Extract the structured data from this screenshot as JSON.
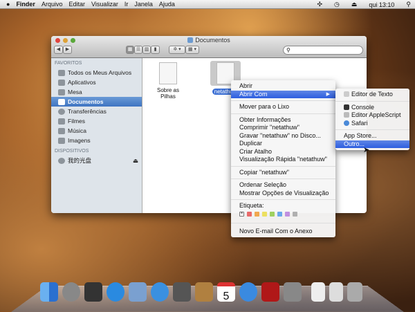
{
  "menubar": {
    "apple": "",
    "items": [
      "Finder",
      "Arquivo",
      "Editar",
      "Visualizar",
      "Ir",
      "Janela",
      "Ajuda"
    ],
    "clock": "qui 13:10",
    "status_icons": [
      "bluetooth-icon",
      "time-machine-icon",
      "eject-icon",
      "spotlight-icon"
    ]
  },
  "window": {
    "title": "Documentos",
    "search_placeholder": "",
    "nav_back": "◀",
    "nav_fwd": "▶",
    "action": "✲ ▾",
    "arrange": "▦ ▾"
  },
  "sidebar": {
    "favorites_header": "FAVORITOS",
    "favorites": [
      "Todos os Meus Arquivos",
      "Aplicativos",
      "Mesa",
      "Documentos",
      "Transferências",
      "Filmes",
      "Música",
      "Imagens"
    ],
    "devices_header": "DISPOSITIVOS",
    "devices": [
      "我的光盘"
    ]
  },
  "files": [
    {
      "name": "Sobre as Pilhas"
    },
    {
      "name": "netathuw"
    }
  ],
  "context_menu": {
    "items": [
      "Abrir",
      "Abrir Com",
      "Mover para o Lixo",
      "Obter Informações",
      "Comprimir \"netathuw\"",
      "Gravar \"netathuw\" no Disco...",
      "Duplicar",
      "Criar Atalho",
      "Visualização Rápida \"netathuw\"",
      "Copiar \"netathuw\"",
      "Ordenar Seleção",
      "Mostrar Opções de Visualização",
      "Etiqueta:",
      "Novo E-mail Com o Anexo"
    ],
    "tag_colors": [
      "#e86a6a",
      "#f0a850",
      "#ece060",
      "#9ed060",
      "#6aa8ec",
      "#c090e0",
      "#b0b0b0"
    ]
  },
  "submenu": {
    "items": [
      "Editor de Texto",
      "Console",
      "Editor AppleScript",
      "Safari",
      "App Store...",
      "Outro..."
    ]
  },
  "dock": {
    "apps": [
      "Finder",
      "Launchpad",
      "Mission Control",
      "App Store",
      "Mail",
      "Safari",
      "FaceTime",
      "Contatos",
      "iCal",
      "iTunes",
      "Photo Booth",
      "Preferências do Sistema",
      "Documento",
      "Arquivo",
      "Lixo"
    ],
    "ical_day": "5"
  }
}
